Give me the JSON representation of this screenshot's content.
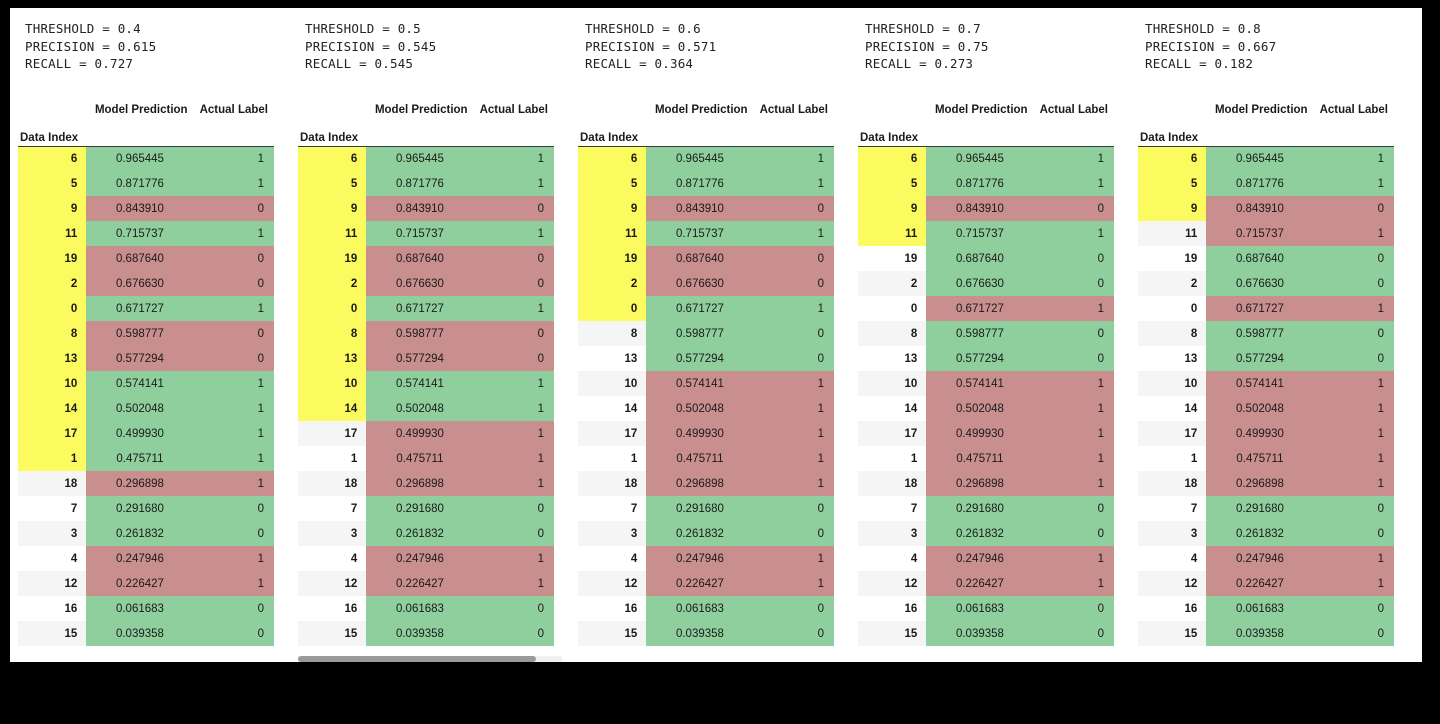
{
  "columns": {
    "index_header": "Data Index",
    "prediction_header": "Model Prediction",
    "label_header": "Actual Label"
  },
  "colors": {
    "highlight": "#fbfb5f",
    "correct": "#8fcf9e",
    "incorrect": "#c98f8f",
    "row_alt": "#f5f5f5",
    "frame": "#000000"
  },
  "rows": [
    {
      "index": "6",
      "prediction": "0.965445",
      "label": "1"
    },
    {
      "index": "5",
      "prediction": "0.871776",
      "label": "1"
    },
    {
      "index": "9",
      "prediction": "0.843910",
      "label": "0"
    },
    {
      "index": "11",
      "prediction": "0.715737",
      "label": "1"
    },
    {
      "index": "19",
      "prediction": "0.687640",
      "label": "0"
    },
    {
      "index": "2",
      "prediction": "0.676630",
      "label": "0"
    },
    {
      "index": "0",
      "prediction": "0.671727",
      "label": "1"
    },
    {
      "index": "8",
      "prediction": "0.598777",
      "label": "0"
    },
    {
      "index": "13",
      "prediction": "0.577294",
      "label": "0"
    },
    {
      "index": "10",
      "prediction": "0.574141",
      "label": "1"
    },
    {
      "index": "14",
      "prediction": "0.502048",
      "label": "1"
    },
    {
      "index": "17",
      "prediction": "0.499930",
      "label": "1"
    },
    {
      "index": "1",
      "prediction": "0.475711",
      "label": "1"
    },
    {
      "index": "18",
      "prediction": "0.296898",
      "label": "1"
    },
    {
      "index": "7",
      "prediction": "0.291680",
      "label": "0"
    },
    {
      "index": "3",
      "prediction": "0.261832",
      "label": "0"
    },
    {
      "index": "4",
      "prediction": "0.247946",
      "label": "1"
    },
    {
      "index": "12",
      "prediction": "0.226427",
      "label": "1"
    },
    {
      "index": "16",
      "prediction": "0.061683",
      "label": "0"
    },
    {
      "index": "15",
      "prediction": "0.039358",
      "label": "0"
    }
  ],
  "panels": [
    {
      "metrics": {
        "threshold": "THRESHOLD = 0.4",
        "precision": "PRECISION = 0.615",
        "recall": "RECALL = 0.727"
      },
      "threshold_value": 0.4,
      "precision_value": 0.615,
      "recall_value": 0.727,
      "predicted_positive_count": 13,
      "has_scrollbar": false
    },
    {
      "metrics": {
        "threshold": "THRESHOLD = 0.5",
        "precision": "PRECISION = 0.545",
        "recall": "RECALL = 0.545"
      },
      "threshold_value": 0.5,
      "precision_value": 0.545,
      "recall_value": 0.545,
      "predicted_positive_count": 11,
      "has_scrollbar": true
    },
    {
      "metrics": {
        "threshold": "THRESHOLD = 0.6",
        "precision": "PRECISION = 0.571",
        "recall": "RECALL = 0.364"
      },
      "threshold_value": 0.6,
      "precision_value": 0.571,
      "recall_value": 0.364,
      "predicted_positive_count": 7,
      "has_scrollbar": false
    },
    {
      "metrics": {
        "threshold": "THRESHOLD = 0.7",
        "precision": "PRECISION = 0.75",
        "recall": "RECALL = 0.273"
      },
      "threshold_value": 0.7,
      "precision_value": 0.75,
      "recall_value": 0.273,
      "predicted_positive_count": 4,
      "has_scrollbar": false
    },
    {
      "metrics": {
        "threshold": "THRESHOLD = 0.8",
        "precision": "PRECISION = 0.667",
        "recall": "RECALL = 0.182"
      },
      "threshold_value": 0.8,
      "precision_value": 0.667,
      "recall_value": 0.182,
      "predicted_positive_count": 3,
      "has_scrollbar": false
    }
  ]
}
